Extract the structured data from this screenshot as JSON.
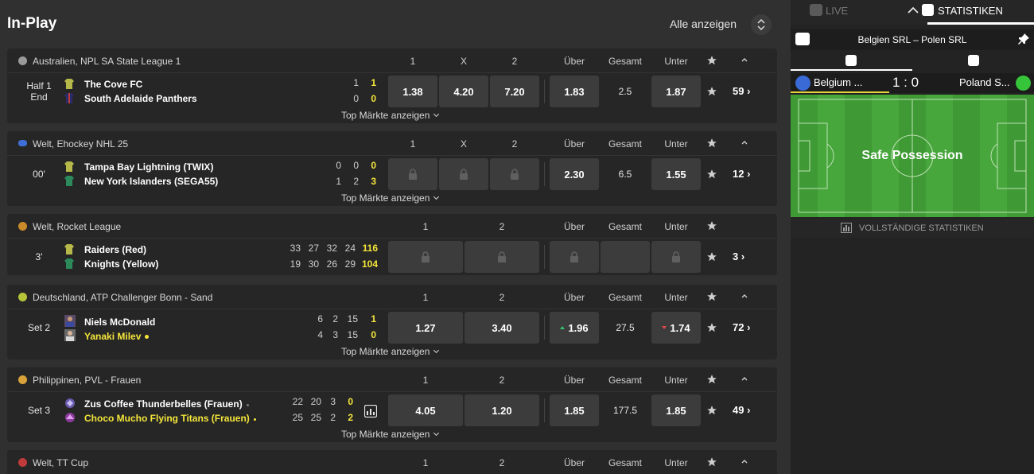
{
  "header": {
    "title": "In-Play",
    "show_all": "Alle anzeigen"
  },
  "top_markets_label": "Top Märkte anzeigen",
  "columns": {
    "one": "1",
    "x": "X",
    "two": "2",
    "over": "Über",
    "total": "Gesamt",
    "under": "Unter"
  },
  "leagues": [
    {
      "name": "Australien, NPL SA State League 1",
      "sport_color": "#9a9a9a",
      "time": "Half 1",
      "time2": "End",
      "teams": [
        "The Cove FC",
        "South Adelaide Panthers"
      ],
      "scores_home": [
        "1"
      ],
      "scores_away": [
        "0"
      ],
      "total_home": "1",
      "total_away": "0",
      "odds": [
        "1.38",
        "4.20",
        "7.20"
      ],
      "over": "1.83",
      "total": "2.5",
      "under": "1.87",
      "more": "59"
    },
    {
      "name": "Welt, Ehockey NHL 25",
      "sport_color": "#3f6fd6",
      "time": "00'",
      "teams": [
        "Tampa Bay Lightning (TWIX)",
        "New York Islanders (SEGA55)"
      ],
      "scores_home": [
        "0",
        "0"
      ],
      "scores_away": [
        "1",
        "2"
      ],
      "total_home": "0",
      "total_away": "3",
      "over": "2.30",
      "total": "6.5",
      "under": "1.55",
      "more": "12"
    },
    {
      "name": "Welt, Rocket League",
      "sport_color": "#c98a2a",
      "time": "3'",
      "teams": [
        "Raiders (Red)",
        "Knights (Yellow)"
      ],
      "scores_home": [
        "33",
        "27",
        "32",
        "24"
      ],
      "scores_away": [
        "19",
        "30",
        "26",
        "29"
      ],
      "total_home": "116",
      "total_away": "104",
      "more": "3"
    },
    {
      "name": "Deutschland, ATP Challenger Bonn - Sand",
      "sport_color": "#b6c43a",
      "time": "Set 2",
      "teams": [
        "Niels McDonald",
        "Yanaki Milev"
      ],
      "scores_home": [
        "6",
        "2",
        "15"
      ],
      "scores_away": [
        "4",
        "3",
        "15"
      ],
      "total_home": "1",
      "total_away": "0",
      "odds": [
        "1.27",
        "3.40"
      ],
      "over": "1.96",
      "total": "27.5",
      "under": "1.74",
      "more": "72"
    },
    {
      "name": "Philippinen, PVL - Frauen",
      "sport_color": "#d9a33a",
      "time": "Set 3",
      "teams": [
        "Zus Coffee Thunderbelles (Frauen)",
        "Choco Mucho Flying Titans (Frauen)"
      ],
      "scores_home": [
        "22",
        "20",
        "3"
      ],
      "scores_away": [
        "25",
        "25",
        "2"
      ],
      "total_home": "0",
      "total_away": "2",
      "odds": [
        "4.05",
        "1.20"
      ],
      "over": "1.85",
      "total": "177.5",
      "under": "1.85",
      "more": "49"
    },
    {
      "name": "Welt, TT Cup",
      "sport_color": "#c0393b"
    }
  ],
  "right_panel": {
    "tab_live": "LIVE",
    "tab_stats": "STATISTIKEN",
    "match_title": "Belgien SRL – Polen SRL",
    "home_name": "Belgium ...",
    "away_name": "Poland S...",
    "score": "1 : 0",
    "possession": "Safe Possession",
    "full_stats": "VOLLSTÄNDIGE STATISTIKEN"
  }
}
